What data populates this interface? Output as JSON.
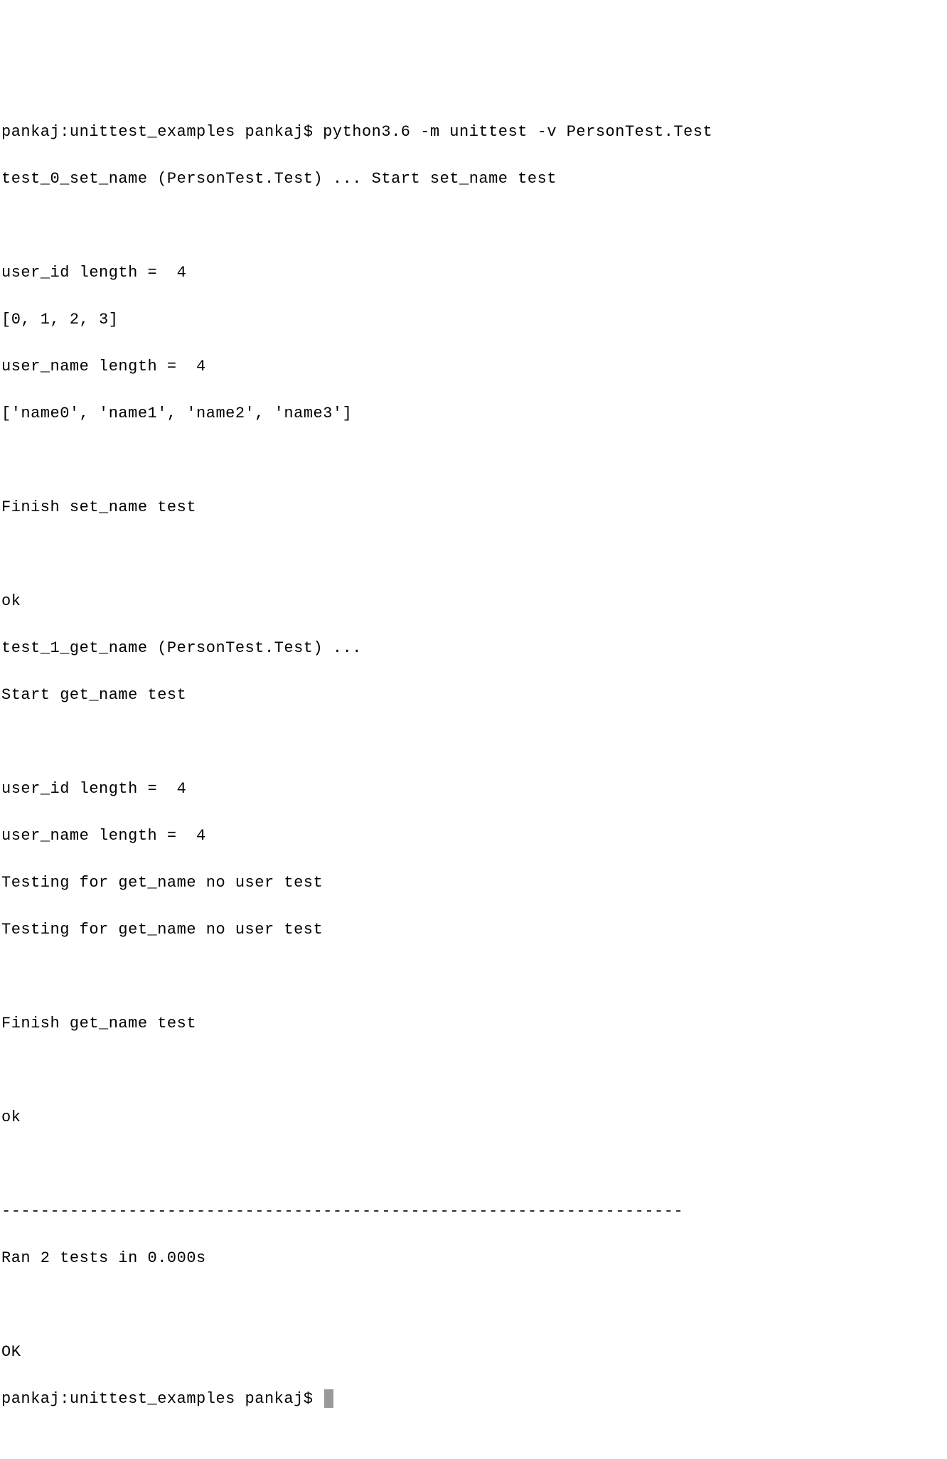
{
  "terminal": {
    "lines": [
      "pankaj:unittest_examples pankaj$ python3.6 -m unittest -v PersonTest.Test",
      "test_0_set_name (PersonTest.Test) ... Start set_name test",
      "",
      "user_id length =  4",
      "[0, 1, 2, 3]",
      "user_name length =  4",
      "['name0', 'name1', 'name2', 'name3']",
      "",
      "Finish set_name test",
      "",
      "ok",
      "test_1_get_name (PersonTest.Test) ... ",
      "Start get_name test",
      "",
      "user_id length =  4",
      "user_name length =  4",
      "Testing for get_name no user test",
      "Testing for get_name no user test",
      "",
      "Finish get_name test",
      "",
      "ok",
      "",
      "----------------------------------------------------------------------",
      "Ran 2 tests in 0.000s",
      "",
      "OK"
    ],
    "prompt": "pankaj:unittest_examples pankaj$ "
  }
}
